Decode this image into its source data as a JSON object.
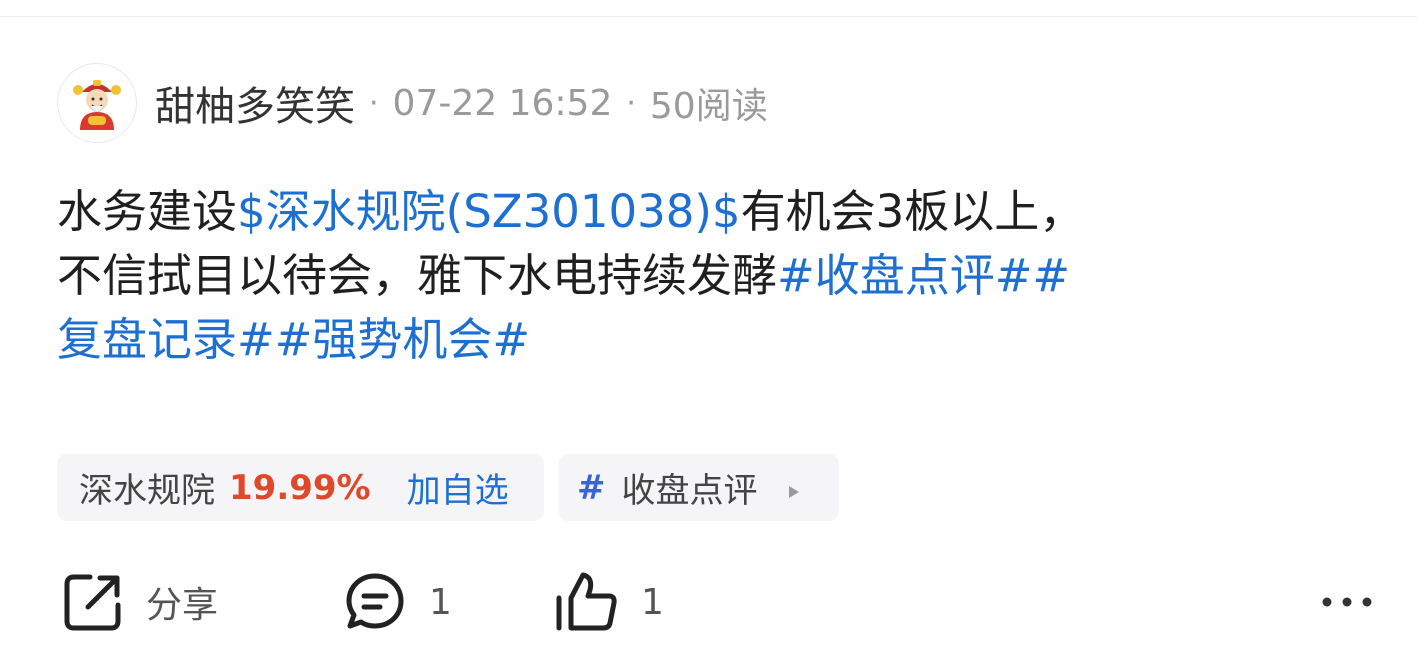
{
  "post": {
    "author": "甜柚多笑笑",
    "time": "07-22 16:52",
    "reads": "50阅读",
    "separator": "·",
    "lines": [
      {
        "t1": "水务建设",
        "link": "$深水规院(SZ301038)$",
        "t2": "有机会3板以上，"
      },
      {
        "t1": "不信拭目以待会，雅下水电持续发酵",
        "link": "#收盘点评##"
      },
      {
        "link": "复盘记录##强势机会#"
      }
    ]
  },
  "chips": {
    "stock": {
      "name": "深水规院",
      "change": "19.99%",
      "action": "加自选"
    },
    "topic": {
      "hash": "#",
      "name": "收盘点评"
    }
  },
  "actions": {
    "share": "分享",
    "comment_count": "1",
    "like_count": "1"
  },
  "icons": {
    "avatar": "caishen-avatar-icon",
    "share": "share-icon",
    "comment": "comment-icon",
    "like": "thumbs-up-icon",
    "more": "more-icon",
    "topic_arrow": "play-icon"
  },
  "colors": {
    "link": "#1d6fd1",
    "stock_change": "#e0482a",
    "meta": "#9a9a9a"
  }
}
